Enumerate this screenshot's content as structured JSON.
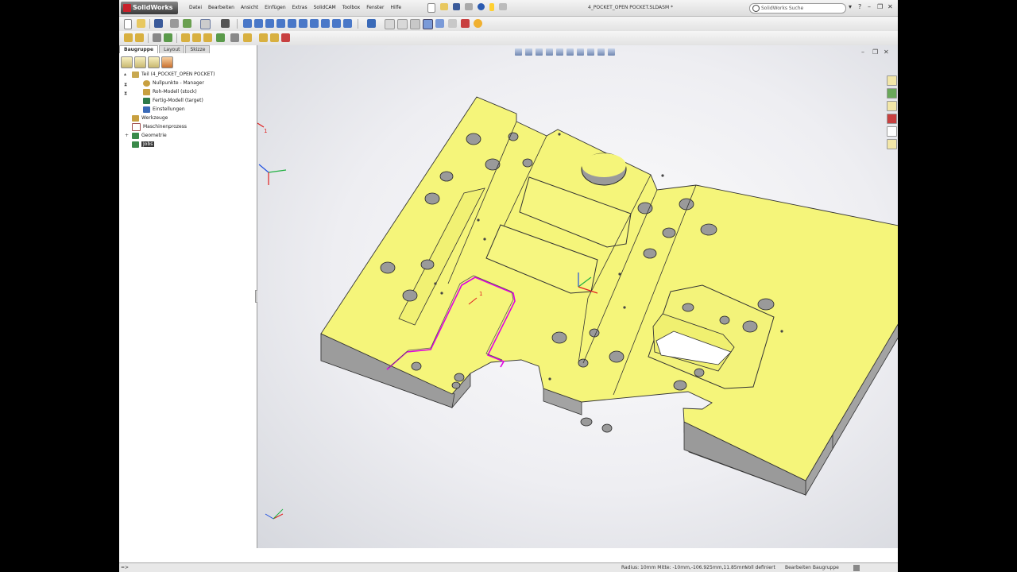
{
  "app": {
    "logo_text": "SolidWorks",
    "document_title": "4_POCKET_OPEN POCKET.SLDASM *",
    "search_placeholder": "SolidWorks Suche"
  },
  "menu": [
    "Datei",
    "Bearbeiten",
    "Ansicht",
    "Einfügen",
    "Extras",
    "SolidCAM",
    "Toolbox",
    "Fenster",
    "Hilfe"
  ],
  "panel_tabs": [
    "Baugruppe",
    "Layout",
    "Skizze"
  ],
  "tree": {
    "root": "Teil (4_POCKET_OPEN POCKET)",
    "items": [
      "Nullpunkte - Manager",
      "Roh-Modell (stock)",
      "Fertig-Modell (target)",
      "Einstellungen"
    ],
    "top_items": [
      "Werkzeuge",
      "Maschinenprozess",
      "Geometrie",
      "Jobs"
    ]
  },
  "viewport": {
    "triad_label": "1",
    "origin_label": "1"
  },
  "status": {
    "coords": "Radius: 10mm  Mitte: -10mm,-106.925mm,11.85mm",
    "state": "Voll definiert",
    "mode": "Bearbeiten Baugruppe",
    "left_arrows": "=>"
  },
  "colors": {
    "part_face": "#f5f57a",
    "part_side": "#a8a8a8",
    "highlight": "#e000e0",
    "selected_bg": "#3a3a3a"
  }
}
